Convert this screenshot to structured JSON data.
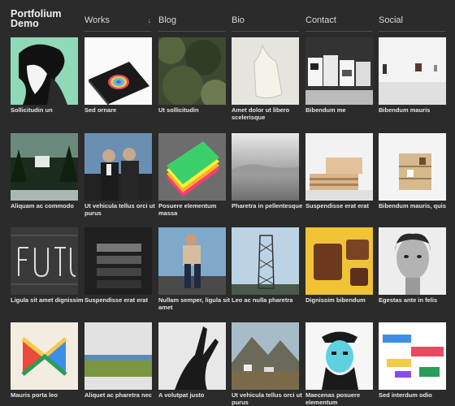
{
  "site": {
    "title_line1": "Portfolium",
    "title_line2": "Demo"
  },
  "nav": [
    {
      "label": "Works",
      "has_dropdown": true
    },
    {
      "label": "Blog"
    },
    {
      "label": "Bio"
    },
    {
      "label": "Contact"
    },
    {
      "label": "Social"
    }
  ],
  "dropdown_glyph": "↓",
  "works": [
    {
      "caption": "Sollicitudin un",
      "thumb": "portrait-inkblot"
    },
    {
      "caption": "Sed ornare",
      "thumb": "color-wheel-book"
    },
    {
      "caption": "Ut sollicitudin",
      "thumb": "tree-foliage"
    },
    {
      "caption": "Amet dolor ut libero scelerisque",
      "thumb": "canvas-tote-bag"
    },
    {
      "caption": "Bibendum me",
      "thumb": "cards-on-table"
    },
    {
      "caption": "Bibendum mauris",
      "thumb": "white-gallery-wall"
    },
    {
      "caption": "Aliquam ac commodo",
      "thumb": "forest-house"
    },
    {
      "caption": "Ut vehicula tellus orci ut purus",
      "thumb": "two-men-suits"
    },
    {
      "caption": "Posuere elementum massa",
      "thumb": "rainbow-paper-stack"
    },
    {
      "caption": "Pharetra in pellentesque",
      "thumb": "misty-sea"
    },
    {
      "caption": "Suspendisse erat erat",
      "thumb": "wooden-pallets"
    },
    {
      "caption": "Bibendum mauris, quis",
      "thumb": "shelving-unit"
    },
    {
      "caption": "Ligula sit amet dignissim",
      "thumb": "futura-lettering"
    },
    {
      "caption": "Suspendisse erat erat",
      "thumb": "stairwell"
    },
    {
      "caption": "Nullam semper, ligula sit amet",
      "thumb": "man-sitting-beach"
    },
    {
      "caption": "Leo ac nulla pharetra",
      "thumb": "lattice-tower"
    },
    {
      "caption": "Dignissim bibendum",
      "thumb": "chocolate-pieces"
    },
    {
      "caption": "Egestas ante in felis",
      "thumb": "woman-portrait-bw"
    },
    {
      "caption": "Mauris porta leo",
      "thumb": "colorful-x-shape"
    },
    {
      "caption": "Aliquet ac pharetra nec",
      "thumb": "green-envelope"
    },
    {
      "caption": "A volutpat justo",
      "thumb": "hand-silhouette"
    },
    {
      "caption": "Ut vehicula tellus orci ut purus",
      "thumb": "mountain-village-painting"
    },
    {
      "caption": "Maecenas posuere elementum",
      "thumb": "illustrated-captain"
    },
    {
      "caption": "Sed interdum odio",
      "thumb": "abstract-color-blocks"
    }
  ]
}
